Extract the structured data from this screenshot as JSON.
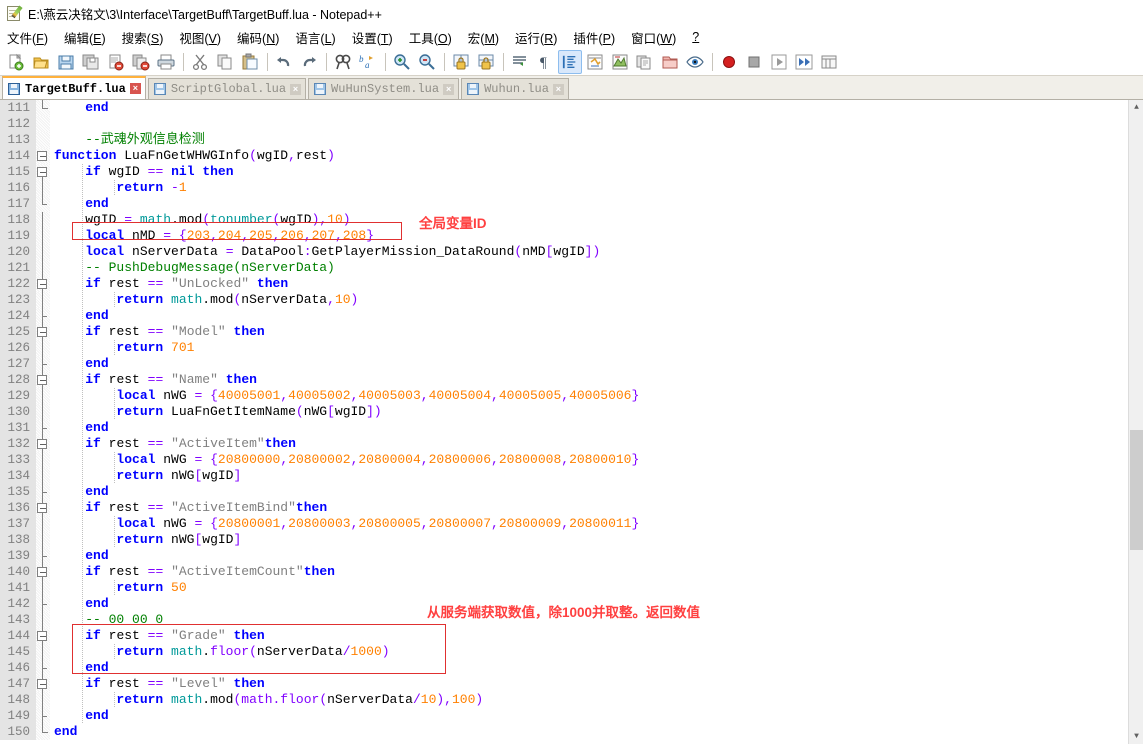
{
  "window": {
    "title": "E:\\燕云决铭文\\3\\Interface\\TargetBuff\\TargetBuff.lua - Notepad++",
    "app_icon": "notepad-plus-plus-icon"
  },
  "menubar": {
    "items": [
      {
        "label": "文件(F)",
        "accel": "F"
      },
      {
        "label": "编辑(E)",
        "accel": "E"
      },
      {
        "label": "搜索(S)",
        "accel": "S"
      },
      {
        "label": "视图(V)",
        "accel": "V"
      },
      {
        "label": "编码(N)",
        "accel": "N"
      },
      {
        "label": "语言(L)",
        "accel": "L"
      },
      {
        "label": "设置(T)",
        "accel": "T"
      },
      {
        "label": "工具(O)",
        "accel": "O"
      },
      {
        "label": "宏(M)",
        "accel": "M"
      },
      {
        "label": "运行(R)",
        "accel": "R"
      },
      {
        "label": "插件(P)",
        "accel": "P"
      },
      {
        "label": "窗口(W)",
        "accel": "W"
      },
      {
        "label": "?",
        "accel": ""
      }
    ]
  },
  "toolbar": {
    "buttons": [
      {
        "name": "new-file-icon",
        "glyph": "📄"
      },
      {
        "name": "open-file-icon",
        "glyph": "📂"
      },
      {
        "name": "save-icon",
        "glyph": "💾"
      },
      {
        "name": "save-all-icon",
        "glyph": "🖫"
      },
      {
        "name": "close-file-icon",
        "glyph": "📕"
      },
      {
        "name": "close-all-files-icon",
        "glyph": "🗗"
      },
      {
        "name": "print-icon",
        "glyph": "🖨"
      },
      {
        "name": "separator-1",
        "glyph": "|"
      },
      {
        "name": "cut-icon",
        "glyph": "✂"
      },
      {
        "name": "copy-icon",
        "glyph": "📋"
      },
      {
        "name": "paste-icon",
        "glyph": "📌"
      },
      {
        "name": "separator-2",
        "glyph": "|"
      },
      {
        "name": "undo-icon",
        "glyph": "↶"
      },
      {
        "name": "redo-icon",
        "glyph": "↷"
      },
      {
        "name": "separator-3",
        "glyph": "|"
      },
      {
        "name": "find-icon",
        "glyph": "🔍"
      },
      {
        "name": "replace-icon",
        "glyph": "ab"
      },
      {
        "name": "separator-4",
        "glyph": "|"
      },
      {
        "name": "zoom-in-icon",
        "glyph": "🔎+"
      },
      {
        "name": "zoom-out-icon",
        "glyph": "🔎-"
      },
      {
        "name": "separator-5",
        "glyph": "|"
      },
      {
        "name": "sync-vertical-scroll-icon",
        "glyph": "⊞"
      },
      {
        "name": "sync-horizontal-scroll-icon",
        "glyph": "⊟"
      },
      {
        "name": "separator-6",
        "glyph": "|"
      },
      {
        "name": "word-wrap-icon",
        "glyph": "≡"
      },
      {
        "name": "show-all-chars-icon",
        "glyph": "¶"
      },
      {
        "name": "indent-guide-icon",
        "glyph": "☷"
      },
      {
        "name": "show-ui-icon",
        "glyph": "⚡"
      },
      {
        "name": "user-defined-dialog-icon",
        "glyph": "🗺"
      },
      {
        "name": "document-map-icon",
        "glyph": "📑"
      },
      {
        "name": "function-list-icon",
        "glyph": "✎"
      },
      {
        "name": "folder-as-workspace-icon",
        "glyph": "📁"
      },
      {
        "name": "monitoring-icon",
        "glyph": "👁"
      },
      {
        "name": "separator-7",
        "glyph": "|"
      },
      {
        "name": "macro-record-icon",
        "glyph": "●"
      },
      {
        "name": "macro-stop-icon",
        "glyph": "■"
      },
      {
        "name": "macro-play-icon",
        "glyph": "▶"
      },
      {
        "name": "macro-play-multiple-icon",
        "glyph": "▶▶"
      },
      {
        "name": "macro-save-icon",
        "glyph": "▤"
      }
    ]
  },
  "tabs": [
    {
      "label": "TargetBuff.lua",
      "active": true,
      "close": "×"
    },
    {
      "label": "ScriptGlobal.lua",
      "active": false,
      "close": "×"
    },
    {
      "label": "WuHunSystem.lua",
      "active": false,
      "close": "×"
    },
    {
      "label": "Wuhun.lua",
      "active": false,
      "close": "×"
    }
  ],
  "editor": {
    "first_line_number": 111,
    "lines": [
      {
        "n": 111,
        "text": "    end"
      },
      {
        "n": 112,
        "text": ""
      },
      {
        "n": 113,
        "text": "    --武魂外观信息检测"
      },
      {
        "n": 114,
        "text": "function LuaFnGetWHWGInfo(wgID,rest)"
      },
      {
        "n": 115,
        "text": "    if wgID == nil then"
      },
      {
        "n": 116,
        "text": "        return -1"
      },
      {
        "n": 117,
        "text": "    end"
      },
      {
        "n": 118,
        "text": "    wgID = math.mod(tonumber(wgID),10)"
      },
      {
        "n": 119,
        "text": "    local nMD = {203,204,205,206,207,208}"
      },
      {
        "n": 120,
        "text": "    local nServerData = DataPool:GetPlayerMission_DataRound(nMD[wgID])"
      },
      {
        "n": 121,
        "text": "    -- PushDebugMessage(nServerData)"
      },
      {
        "n": 122,
        "text": "    if rest == \"UnLocked\" then"
      },
      {
        "n": 123,
        "text": "        return math.mod(nServerData,10)"
      },
      {
        "n": 124,
        "text": "    end"
      },
      {
        "n": 125,
        "text": "    if rest == \"Model\" then"
      },
      {
        "n": 126,
        "text": "        return 701"
      },
      {
        "n": 127,
        "text": "    end"
      },
      {
        "n": 128,
        "text": "    if rest == \"Name\" then"
      },
      {
        "n": 129,
        "text": "        local nWG = {40005001,40005002,40005003,40005004,40005005,40005006}"
      },
      {
        "n": 130,
        "text": "        return LuaFnGetItemName(nWG[wgID])"
      },
      {
        "n": 131,
        "text": "    end"
      },
      {
        "n": 132,
        "text": "    if rest == \"ActiveItem\"then"
      },
      {
        "n": 133,
        "text": "        local nWG = {20800000,20800002,20800004,20800006,20800008,20800010}"
      },
      {
        "n": 134,
        "text": "        return nWG[wgID]"
      },
      {
        "n": 135,
        "text": "    end"
      },
      {
        "n": 136,
        "text": "    if rest == \"ActiveItemBind\"then"
      },
      {
        "n": 137,
        "text": "        local nWG = {20800001,20800003,20800005,20800007,20800009,20800011}"
      },
      {
        "n": 138,
        "text": "        return nWG[wgID]"
      },
      {
        "n": 139,
        "text": "    end"
      },
      {
        "n": 140,
        "text": "    if rest == \"ActiveItemCount\"then"
      },
      {
        "n": 141,
        "text": "        return 50"
      },
      {
        "n": 142,
        "text": "    end"
      },
      {
        "n": 143,
        "text": "    -- 00 00 0"
      },
      {
        "n": 144,
        "text": "    if rest == \"Grade\" then"
      },
      {
        "n": 145,
        "text": "        return math.floor(nServerData/1000)"
      },
      {
        "n": 146,
        "text": "    end"
      },
      {
        "n": 147,
        "text": "    if rest == \"Level\" then"
      },
      {
        "n": 148,
        "text": "        return math.mod(math.floor(nServerData/10),100)"
      },
      {
        "n": 149,
        "text": "    end"
      },
      {
        "n": 150,
        "text": "end"
      }
    ]
  },
  "annotations": [
    {
      "name": "annotation-global-variable-id",
      "text": "全局变量ID",
      "color": "#ff4040"
    },
    {
      "name": "annotation-server-value",
      "text": "从服务端获取数值，除1000并取整。返回数值",
      "color": "#ff4040"
    }
  ],
  "highlight_boxes": [
    {
      "name": "highlight-box-nmd-line",
      "color": "#e03030"
    },
    {
      "name": "highlight-box-grade-block",
      "color": "#e03030"
    }
  ],
  "colors": {
    "keyword": "#0000ff",
    "number": "#ff8000",
    "string": "#808080",
    "comment": "#008000",
    "library": "#009999",
    "operator": "#8000ff",
    "annotation": "#ff4040",
    "gutter_bg": "#e4e4e4",
    "active_tab_top": "#ffb13c"
  }
}
